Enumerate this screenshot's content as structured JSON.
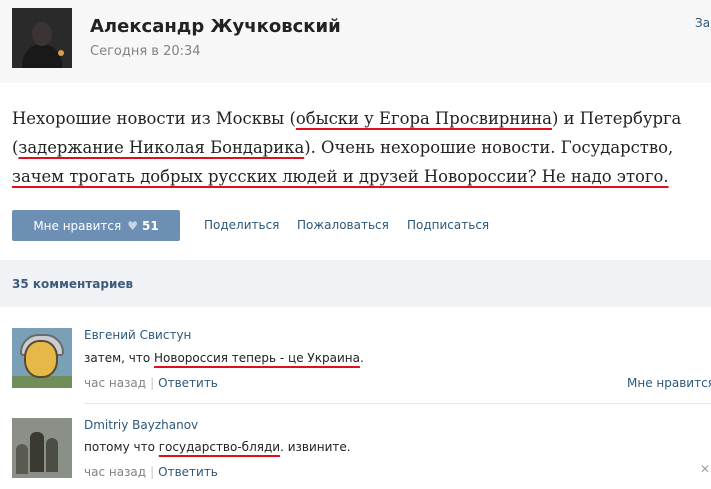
{
  "post": {
    "author": "Александр Жучковский",
    "date": "Сегодня в 20:34",
    "corner_link": "Зап",
    "text": {
      "p1": "Нехорошие новости из Москвы (",
      "u1": "обыски у Егора Просвирнина",
      "p2": ") и Петербурга (",
      "u2": "задержание Николая Бондарика",
      "p3": "). Очень нехорошие новости. Государство, ",
      "u3": "зачем трогать добрых русских людей и друзей Новороссии? Не надо этого.",
      "underline_color": "#e0101a"
    },
    "like_label": "Мне нравится",
    "like_count": "51",
    "actions": {
      "share": "Поделиться",
      "report": "Пожаловаться",
      "subscribe": "Подписаться"
    }
  },
  "comments_header": "35 комментариев",
  "comments": [
    {
      "author": "Евгений Свистун",
      "text_before": "затем, что ",
      "text_underlined": "Новороссия теперь - це Украина",
      "text_after": ".",
      "time": "час назад",
      "sep": "|",
      "reply": "Ответить",
      "like": "Мне нравится"
    },
    {
      "author": "Dmitriy Bayzhanov",
      "text_before": "потому что ",
      "text_underlined": "государство-бляди",
      "text_after": ". извините.",
      "time": "час назад",
      "sep": "|",
      "reply": "Ответить"
    }
  ],
  "icons": {
    "heart": "heart-icon",
    "dismiss": "close-icon"
  },
  "colors": {
    "link": "#2b587a",
    "button": "#6d8fb3",
    "underline": "#e0101a"
  }
}
